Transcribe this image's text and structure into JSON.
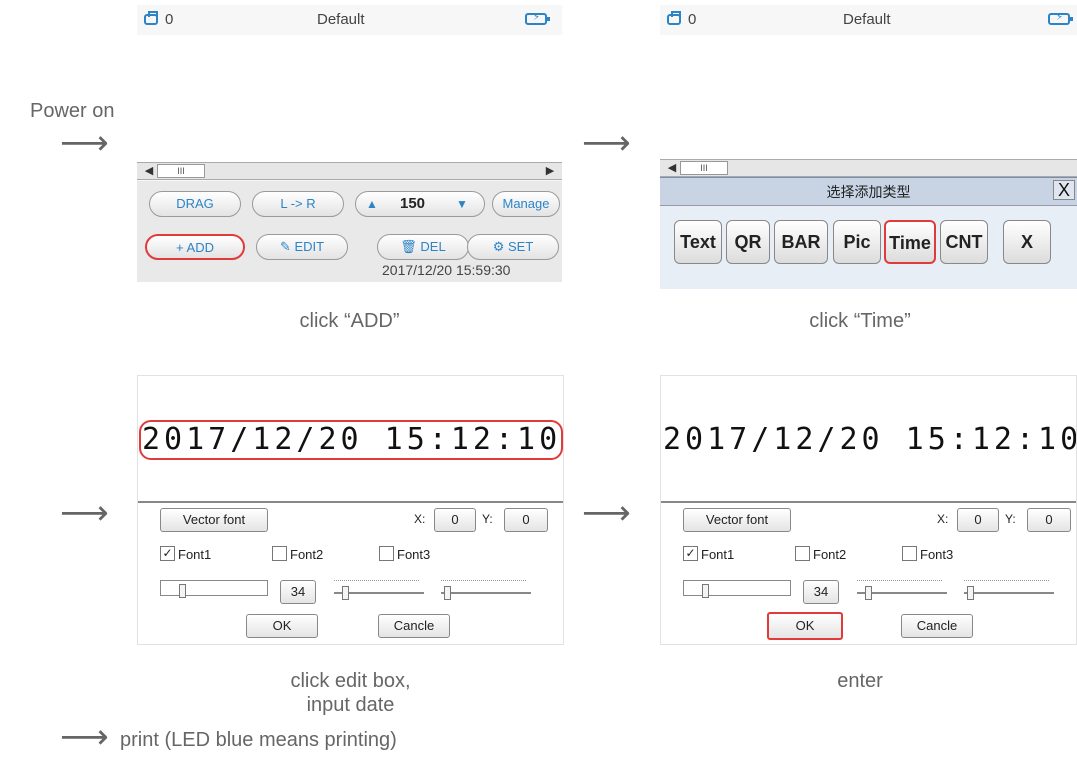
{
  "captions": {
    "power_on": "Power on",
    "click_add": "click “ADD”",
    "click_time": "click “Time”",
    "edit_line1": "click edit box,",
    "edit_line2": "input date",
    "enter": "enter",
    "print": "print (LED blue means printing)"
  },
  "arrow_glyph": "⟶",
  "screen1": {
    "counter": "0",
    "title": "Default",
    "thumb": "III",
    "buttons": {
      "drag": "DRAG",
      "direction": "L -> R",
      "value": "150",
      "manage": "Manage",
      "add": "+ ADD",
      "edit": "✎ EDIT",
      "del": "🗑 DEL",
      "set": "⚙ SET"
    },
    "datetime": "2017/12/20 15:59:30"
  },
  "screen2": {
    "counter": "0",
    "title": "Default",
    "thumb": "III",
    "picker_title": "选择添加类型",
    "close": "X",
    "types": [
      "Text",
      "QR",
      "BAR",
      "Pic",
      "Time",
      "CNT",
      "X"
    ],
    "highlighted": "Time"
  },
  "editor": {
    "time_text": "2017/12/20 15:12:10",
    "vector_font": "Vector font",
    "x_label": "X:",
    "x_value": "0",
    "y_label": "Y:",
    "y_value": "0",
    "fonts": [
      "Font1",
      "Font2",
      "Font3"
    ],
    "font1_checked": true,
    "size_value": "34",
    "ok": "OK",
    "cancel": "Cancle",
    "check_glyph": "✓"
  },
  "colors": {
    "accent": "#2c84c7",
    "highlight": "#e03b3b"
  }
}
